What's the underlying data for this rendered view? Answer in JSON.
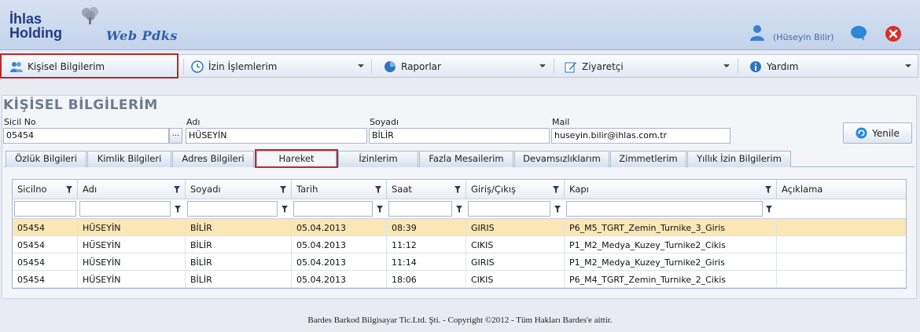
{
  "header": {
    "logo_line1": "İhlas",
    "logo_line2": "Holding",
    "app_title": "Web Pdks",
    "user_name": "(Hüseyin Bilir)"
  },
  "menu": [
    {
      "label": "Kişisel Bilgilerim",
      "icon": "users-icon"
    },
    {
      "label": "İzin İşlemlerim",
      "icon": "clock-icon"
    },
    {
      "label": "Raporlar",
      "icon": "pie-chart-icon"
    },
    {
      "label": "Ziyaretçi",
      "icon": "edit-icon"
    },
    {
      "label": "Yardım",
      "icon": "info-icon"
    }
  ],
  "page_title": "KİŞİSEL BİLGİLERİM",
  "fields": {
    "sicil_label": "Sicil No",
    "sicil_value": "05454",
    "adi_label": "Adı",
    "adi_value": "HÜSEYİN",
    "soyadi_label": "Soyadı",
    "soyadi_value": "BİLİR",
    "mail_label": "Mail",
    "mail_value": "huseyin.bilir@ihlas.com.tr",
    "dots": "..."
  },
  "refresh_label": "Yenile",
  "tabs": [
    "Özlük Bilgileri",
    "Kimlik Bilgileri",
    "Adres Bilgileri",
    "Hareket",
    "İzinlerim",
    "Fazla Mesailerim",
    "Devamsızlıklarım",
    "Zimmetlerim",
    "Yıllık İzin Bilgilerim"
  ],
  "active_tab": "Hareket",
  "grid": {
    "columns": [
      "Sicilno",
      "Adı",
      "Soyadı",
      "Tarih",
      "Saat",
      "Giriş/Çıkış",
      "Kapı",
      "Açıklama"
    ],
    "rows": [
      [
        "05454",
        "HÜSEYİN",
        "BİLİR",
        "05.04.2013",
        "08:39",
        "GIRIS",
        "P6_M5_TGRT_Zemin_Turnike_3_Giris",
        ""
      ],
      [
        "05454",
        "HÜSEYİN",
        "BİLİR",
        "05.04.2013",
        "11:12",
        "CIKIS",
        "P1_M2_Medya_Kuzey_Turnike2_Cikis",
        ""
      ],
      [
        "05454",
        "HÜSEYİN",
        "BİLİR",
        "05.04.2013",
        "11:14",
        "GIRIS",
        "P1_M2_Medya_Kuzey_Turnike2_Giris",
        ""
      ],
      [
        "05454",
        "HÜSEYİN",
        "BİLİR",
        "05.04.2013",
        "18:06",
        "CIKIS",
        "P6_M4_TGRT_Zemin_Turnike_2_Cikis",
        ""
      ]
    ],
    "selected_row": 0
  },
  "footer": "Bardes Barkod Bilgisayar Tic.Ltd. Şti. - Copyright ©2012 - Tüm Hakları Bardes'e aittir.",
  "colors": {
    "accent": "#1e3c82",
    "highlight_border": "#c0262a",
    "selected_row": "#fbe7b5"
  }
}
